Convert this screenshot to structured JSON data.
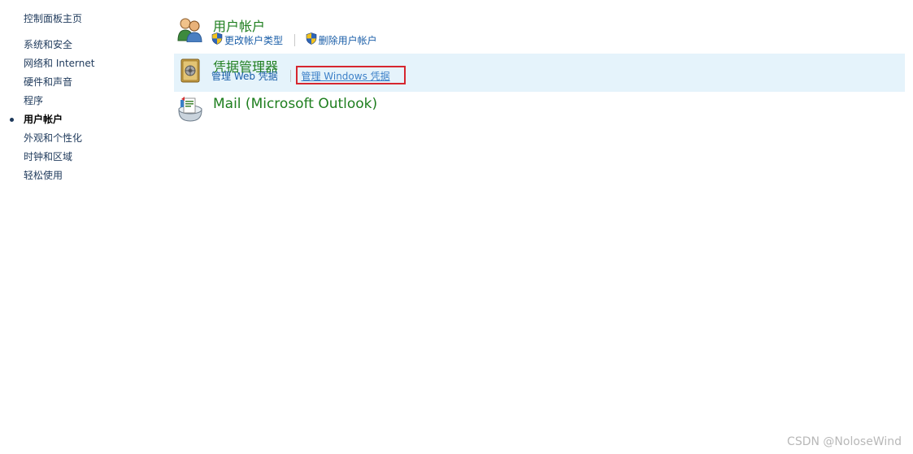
{
  "sidebar": {
    "home": "控制面板主页",
    "items": [
      {
        "label": "系统和安全"
      },
      {
        "label": "网络和 Internet"
      },
      {
        "label": "硬件和声音"
      },
      {
        "label": "程序"
      },
      {
        "label": "用户帐户"
      },
      {
        "label": "外观和个性化"
      },
      {
        "label": "时钟和区域"
      },
      {
        "label": "轻松使用"
      }
    ],
    "active_item": "用户帐户"
  },
  "categories": [
    {
      "title": "用户帐户",
      "icon": "users-icon",
      "links": [
        {
          "label": "更改帐户类型",
          "icon": "uac-shield-icon"
        },
        {
          "label": "删除用户帐户",
          "icon": "uac-shield-icon"
        }
      ]
    },
    {
      "title": "凭据管理器",
      "icon": "credential-vault-icon",
      "highlighted": true,
      "links": [
        {
          "label": "管理 Web 凭据"
        },
        {
          "label": "管理 Windows 凭据",
          "annotated": true
        }
      ]
    },
    {
      "title": "Mail (Microsoft Outlook)",
      "icon": "mail-icon",
      "links": []
    }
  ],
  "watermark": "CSDN @NoloseWind",
  "colors": {
    "title_green": "#1e7e1e",
    "link_blue": "#1a5ea8",
    "highlight_bg": "#e5f3fb",
    "annotation_red": "#d6262f"
  }
}
